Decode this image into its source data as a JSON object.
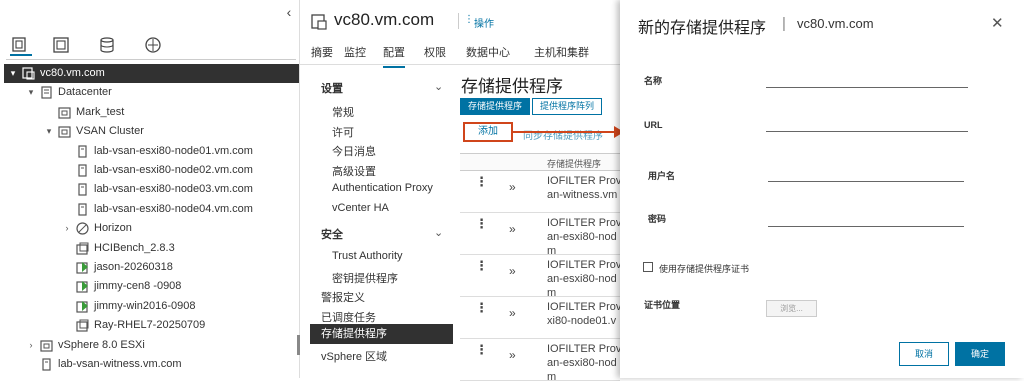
{
  "navigator": {
    "tabs": [
      {
        "icon": "hosts-clusters-icon",
        "active": true
      },
      {
        "icon": "vms-templates-icon",
        "active": false
      },
      {
        "icon": "storage-icon",
        "active": false
      },
      {
        "icon": "networking-icon",
        "active": false
      }
    ],
    "tree": [
      {
        "label": "vc80.vm.com",
        "level": 0,
        "expand": "▾",
        "icon": "vcenter-icon",
        "selected": true
      },
      {
        "label": "Datacenter",
        "level": 1,
        "expand": "▾",
        "icon": "datacenter-icon"
      },
      {
        "label": "Mark_test",
        "level": 2,
        "expand": "",
        "icon": "cluster-icon"
      },
      {
        "label": "VSAN Cluster",
        "level": 2,
        "expand": "▾",
        "icon": "cluster-icon"
      },
      {
        "label": "lab-vsan-esxi80-node01.vm.com",
        "level": 3,
        "expand": "",
        "icon": "host-icon"
      },
      {
        "label": "lab-vsan-esxi80-node02.vm.com",
        "level": 3,
        "expand": "",
        "icon": "host-icon"
      },
      {
        "label": "lab-vsan-esxi80-node03.vm.com",
        "level": 3,
        "expand": "",
        "icon": "host-icon"
      },
      {
        "label": "lab-vsan-esxi80-node04.vm.com",
        "level": 3,
        "expand": "",
        "icon": "host-icon"
      },
      {
        "label": "Horizon",
        "level": 3,
        "expand": "›",
        "icon": "resource-pool-icon"
      },
      {
        "label": "HCIBench_2.8.3",
        "level": 3,
        "expand": "",
        "icon": "vm-icon"
      },
      {
        "label": "jason-20260318",
        "level": 3,
        "expand": "",
        "icon": "vm-on-icon"
      },
      {
        "label": "jimmy-cen8 -0908",
        "level": 3,
        "expand": "",
        "icon": "vm-on-icon"
      },
      {
        "label": "jimmy-win2016-0908",
        "level": 3,
        "expand": "",
        "icon": "vm-on-icon"
      },
      {
        "label": "Ray-RHEL7-20250709",
        "level": 3,
        "expand": "",
        "icon": "vm-icon"
      },
      {
        "label": "vSphere 8.0 ESXi",
        "level": 1,
        "expand": "›",
        "icon": "cluster-icon"
      },
      {
        "label": "lab-vsan-witness.vm.com",
        "level": 1,
        "expand": "",
        "icon": "host-icon"
      }
    ]
  },
  "object": {
    "title": "vc80.vm.com",
    "actions_label": "操作",
    "tabs": [
      "摘要",
      "监控",
      "配置",
      "权限",
      "数据中心",
      "主机和集群"
    ],
    "active_tab": "配置"
  },
  "settings_nav": {
    "groups": [
      {
        "header": "设置",
        "items": [
          "常规",
          "许可",
          "今日消息",
          "高级设置",
          "Authentication Proxy",
          "vCenter HA"
        ]
      },
      {
        "header": "安全",
        "items": [
          "Trust Authority",
          "密钥提供程序"
        ]
      }
    ],
    "top_items": [
      "警报定义",
      "已调度任务",
      "存储提供程序",
      "vSphere 区域"
    ],
    "selected": "存储提供程序"
  },
  "content": {
    "title": "存储提供程序",
    "seg_tabs": [
      "存储提供程序",
      "提供程序阵列"
    ],
    "add_label": "添加",
    "sync_label": "同步存储提供程序",
    "column_header": "存储提供程序",
    "rows": [
      {
        "line1": "IOFILTER Prov",
        "line2": "an-witness.vm"
      },
      {
        "line1": "IOFILTER Prov",
        "line2": "an-esxi80-nod",
        "line3": "m"
      },
      {
        "line1": "IOFILTER Prov",
        "line2": "an-esxi80-nod",
        "line3": "m"
      },
      {
        "line1": "IOFILTER Prov",
        "line2": "xi80-node01.v"
      },
      {
        "line1": "IOFILTER Prov",
        "line2": "an-esxi80-nod",
        "line3": "m"
      }
    ]
  },
  "dialog": {
    "title": "新的存储提供程序",
    "separator": "|",
    "host": "vc80.vm.com",
    "close_icon": "close-icon",
    "fields": [
      {
        "label": "名称",
        "value": ""
      },
      {
        "label": "URL",
        "value": ""
      },
      {
        "label": "用户名",
        "value": ""
      },
      {
        "label": "密码",
        "value": ""
      }
    ],
    "checkbox_label": "使用存储提供程序证书",
    "checkbox_checked": false,
    "cert_label": "证书位置",
    "browse_label": "浏览...",
    "cancel_label": "取消",
    "ok_label": "确定"
  },
  "colors": {
    "accent": "#0072a3",
    "highlight": "#d0451b",
    "selected_bg": "#313131"
  }
}
